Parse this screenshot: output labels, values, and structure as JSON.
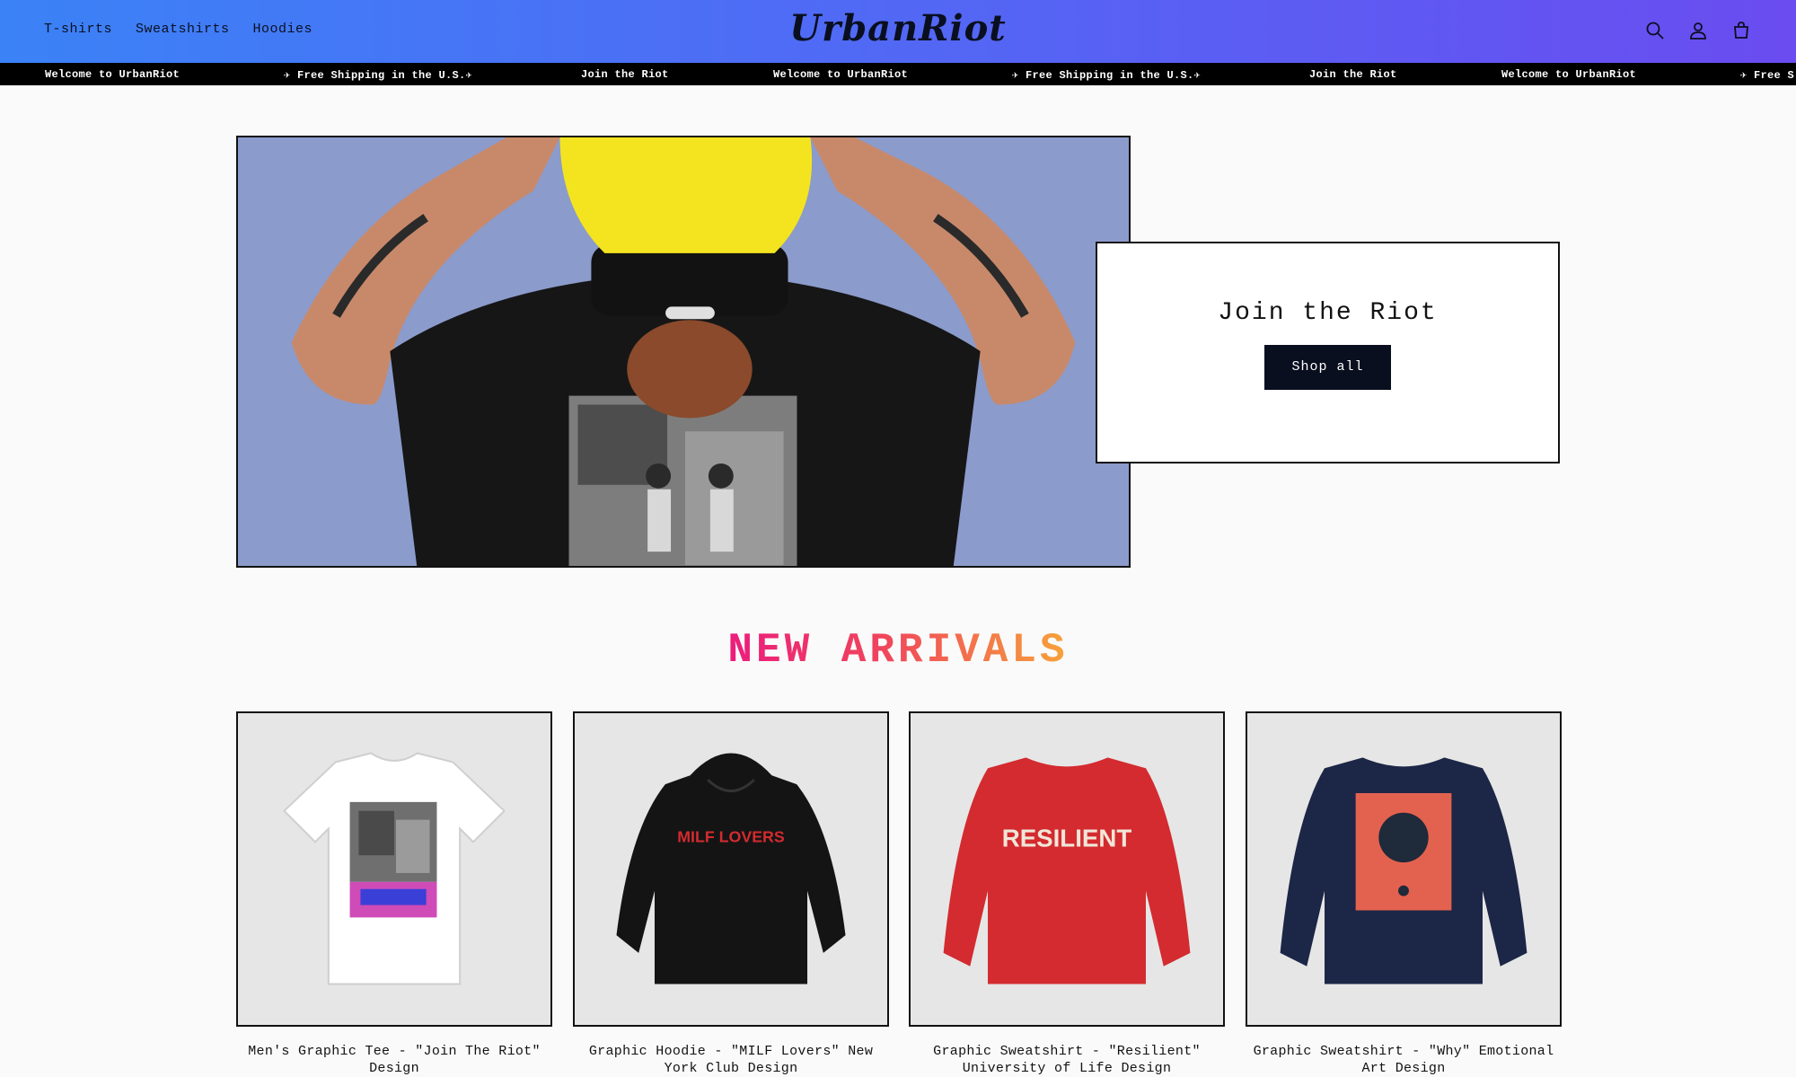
{
  "header": {
    "nav": [
      "T-shirts",
      "Sweatshirts",
      "Hoodies"
    ],
    "logo": "UrbanRiot",
    "icons": [
      "search-icon",
      "account-icon",
      "cart-icon"
    ]
  },
  "ticker": {
    "items": [
      "Welcome to UrbanRiot",
      "✈ Free Shipping in the U.S.✈",
      "Join the Riot",
      "Welcome to UrbanRiot",
      "✈ Free Shipping in the U.S.✈",
      "Join the Riot",
      "Welcome to UrbanRiot",
      "✈ Free S"
    ]
  },
  "hero": {
    "title": "Join the Riot",
    "button": "Shop all",
    "image_bg": "#8b9bcb"
  },
  "arrivals": {
    "title": "NEW ARRIVALS",
    "products": [
      {
        "title": "Men's Graphic Tee - \"Join The Riot\" Design",
        "color": "#ffffff",
        "kind": "tee"
      },
      {
        "title": "Graphic Hoodie - \"MILF Lovers\" New York Club Design",
        "color": "#121212",
        "kind": "hoodie"
      },
      {
        "title": "Graphic Sweatshirt - \"Resilient\" University of Life Design",
        "color": "#d32b2f",
        "kind": "sweatshirt"
      },
      {
        "title": "Graphic Sweatshirt - \"Why\" Emotional Art Design",
        "color": "#1c2646",
        "kind": "sweatshirt"
      }
    ]
  },
  "colors": {
    "header_gradient": [
      "#3b82f6",
      "#6a4cf0"
    ],
    "title_gradient": [
      "#ec1d7d",
      "#f7a33a"
    ],
    "button_bg": "#0a0f1f"
  }
}
